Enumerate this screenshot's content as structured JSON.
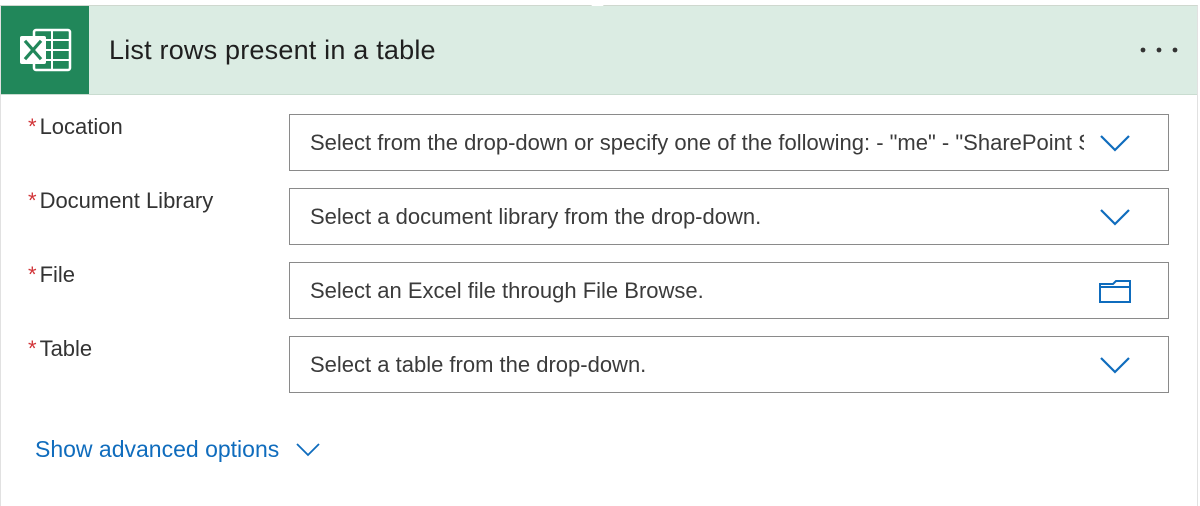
{
  "header": {
    "title": "List rows present in a table",
    "app_icon": "excel-icon",
    "more_icon": "more-options-icon"
  },
  "fields": [
    {
      "label": "Location",
      "required": "*",
      "placeholder": "Select from the drop-down or specify one of the following: - \"me\" - \"SharePoint Site URL\"",
      "icon": "chevron-down-icon"
    },
    {
      "label": "Document Library",
      "required": "*",
      "placeholder": "Select a document library from the drop-down.",
      "icon": "chevron-down-icon"
    },
    {
      "label": "File",
      "required": "*",
      "placeholder": "Select an Excel file through File Browse.",
      "icon": "folder-icon"
    },
    {
      "label": "Table",
      "required": "*",
      "placeholder": "Select a table from the drop-down.",
      "icon": "chevron-down-icon"
    }
  ],
  "advanced": {
    "label": "Show advanced options",
    "icon": "chevron-down-icon"
  },
  "colors": {
    "header_bg": "#dbece3",
    "app_icon_bg": "#21875a",
    "required": "#d13438",
    "link": "#0f6cbd",
    "icon_blue": "#0f6cbd"
  }
}
